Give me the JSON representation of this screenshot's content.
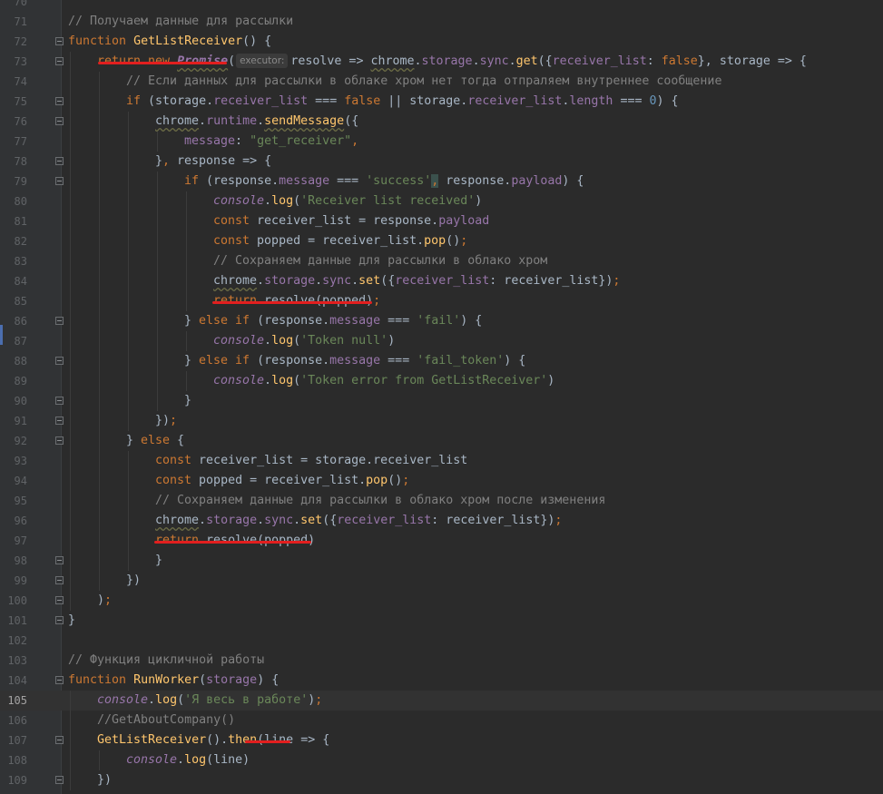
{
  "editor": {
    "current_line": "105",
    "lines": [
      {
        "n": "70",
        "indent": 0,
        "fold": false,
        "tokens": []
      },
      {
        "n": "71",
        "indent": 0,
        "fold": false,
        "tokens": [
          {
            "c": "cm",
            "t": "// Получаем данные для рассылки"
          }
        ]
      },
      {
        "n": "72",
        "indent": 0,
        "fold": true,
        "tokens": [
          {
            "c": "kw",
            "t": "function "
          },
          {
            "c": "fn",
            "t": "GetListReceiver"
          },
          {
            "c": "pl",
            "t": "() {"
          }
        ]
      },
      {
        "n": "73",
        "indent": 1,
        "fold": true,
        "tokens": [
          {
            "c": "kw",
            "t": "return new "
          },
          {
            "c": "cls",
            "t": "Promise"
          },
          {
            "c": "pl",
            "t": "("
          },
          {
            "c": "hint",
            "t": "executor:"
          },
          {
            "c": "pl",
            "t": "resolve => "
          },
          {
            "c": "glob-w",
            "t": "chrome"
          },
          {
            "c": "pl",
            "t": "."
          },
          {
            "c": "prop",
            "t": "storage"
          },
          {
            "c": "pl",
            "t": "."
          },
          {
            "c": "prop",
            "t": "sync"
          },
          {
            "c": "pl",
            "t": "."
          },
          {
            "c": "fn",
            "t": "get"
          },
          {
            "c": "pl",
            "t": "({"
          },
          {
            "c": "prop",
            "t": "receiver_list"
          },
          {
            "c": "pl",
            "t": ": "
          },
          {
            "c": "kw",
            "t": "false"
          },
          {
            "c": "pl",
            "t": "}, storage => {"
          }
        ]
      },
      {
        "n": "74",
        "indent": 2,
        "fold": false,
        "tokens": [
          {
            "c": "cm",
            "t": "// Если данных для рассылки в облаке хром нет тогда отпраляем внутреннее сообщение"
          }
        ]
      },
      {
        "n": "75",
        "indent": 2,
        "fold": true,
        "tokens": [
          {
            "c": "kw",
            "t": "if "
          },
          {
            "c": "pl",
            "t": "(storage."
          },
          {
            "c": "prop",
            "t": "receiver_list"
          },
          {
            "c": "pl",
            "t": " === "
          },
          {
            "c": "kw",
            "t": "false"
          },
          {
            "c": "pl",
            "t": " || storage."
          },
          {
            "c": "prop",
            "t": "receiver_list"
          },
          {
            "c": "pl",
            "t": "."
          },
          {
            "c": "prop",
            "t": "length"
          },
          {
            "c": "pl",
            "t": " === "
          },
          {
            "c": "num",
            "t": "0"
          },
          {
            "c": "pl",
            "t": ") {"
          }
        ]
      },
      {
        "n": "76",
        "indent": 3,
        "fold": true,
        "tokens": [
          {
            "c": "pl-w",
            "t": "chrome"
          },
          {
            "c": "pl",
            "t": "."
          },
          {
            "c": "prop",
            "t": "runtime"
          },
          {
            "c": "pl",
            "t": "."
          },
          {
            "c": "fn-w",
            "t": "sendMessage"
          },
          {
            "c": "pl",
            "t": "({"
          }
        ]
      },
      {
        "n": "77",
        "indent": 4,
        "fold": false,
        "tokens": [
          {
            "c": "prop",
            "t": "message"
          },
          {
            "c": "pl",
            "t": ": "
          },
          {
            "c": "str",
            "t": "\"get_receiver\""
          },
          {
            "c": "kw",
            "t": ","
          }
        ]
      },
      {
        "n": "78",
        "indent": 3,
        "fold": true,
        "tokens": [
          {
            "c": "pl",
            "t": "}"
          },
          {
            "c": "kw",
            "t": ", "
          },
          {
            "c": "pl",
            "t": "response => {"
          }
        ]
      },
      {
        "n": "79",
        "indent": 4,
        "fold": true,
        "tokens": [
          {
            "c": "kw",
            "t": "if "
          },
          {
            "c": "pl",
            "t": "(response."
          },
          {
            "c": "prop",
            "t": "message"
          },
          {
            "c": "pl",
            "t": " === "
          },
          {
            "c": "str",
            "t": "'success'"
          },
          {
            "c": "kw-m",
            "t": ","
          },
          {
            "c": "pl",
            "t": " response."
          },
          {
            "c": "prop",
            "t": "payload"
          },
          {
            "c": "pl",
            "t": ") {"
          }
        ]
      },
      {
        "n": "80",
        "indent": 5,
        "fold": false,
        "tokens": [
          {
            "c": "glob",
            "t": "console"
          },
          {
            "c": "pl",
            "t": "."
          },
          {
            "c": "fn",
            "t": "log"
          },
          {
            "c": "pl",
            "t": "("
          },
          {
            "c": "str",
            "t": "'Receiver list received'"
          },
          {
            "c": "pl",
            "t": ")"
          }
        ]
      },
      {
        "n": "81",
        "indent": 5,
        "fold": false,
        "tokens": [
          {
            "c": "kw",
            "t": "const "
          },
          {
            "c": "pl",
            "t": "receiver_list = response."
          },
          {
            "c": "prop",
            "t": "payload"
          }
        ]
      },
      {
        "n": "82",
        "indent": 5,
        "fold": false,
        "tokens": [
          {
            "c": "kw",
            "t": "const "
          },
          {
            "c": "pl",
            "t": "popped = receiver_list."
          },
          {
            "c": "fn",
            "t": "pop"
          },
          {
            "c": "pl",
            "t": "()"
          },
          {
            "c": "kw",
            "t": ";"
          }
        ]
      },
      {
        "n": "83",
        "indent": 5,
        "fold": false,
        "tokens": [
          {
            "c": "cm",
            "t": "// Сохраняем данные для рассылки в облако хром"
          }
        ]
      },
      {
        "n": "84",
        "indent": 5,
        "fold": false,
        "tokens": [
          {
            "c": "pl-w",
            "t": "chrome"
          },
          {
            "c": "pl",
            "t": "."
          },
          {
            "c": "prop",
            "t": "storage"
          },
          {
            "c": "pl",
            "t": "."
          },
          {
            "c": "prop",
            "t": "sync"
          },
          {
            "c": "pl",
            "t": "."
          },
          {
            "c": "fn",
            "t": "set"
          },
          {
            "c": "pl",
            "t": "({"
          },
          {
            "c": "prop",
            "t": "receiver_list"
          },
          {
            "c": "pl",
            "t": ": receiver_list})"
          },
          {
            "c": "kw",
            "t": ";"
          }
        ]
      },
      {
        "n": "85",
        "indent": 5,
        "fold": false,
        "tokens": [
          {
            "c": "kw",
            "t": "return "
          },
          {
            "c": "pl",
            "t": "resolve(popped)"
          },
          {
            "c": "kw",
            "t": ";"
          }
        ]
      },
      {
        "n": "86",
        "indent": 4,
        "fold": true,
        "tokens": [
          {
            "c": "pl",
            "t": "} "
          },
          {
            "c": "kw",
            "t": "else if "
          },
          {
            "c": "pl",
            "t": "(response."
          },
          {
            "c": "prop",
            "t": "message"
          },
          {
            "c": "pl",
            "t": " === "
          },
          {
            "c": "str",
            "t": "'fail'"
          },
          {
            "c": "pl",
            "t": ") {"
          }
        ]
      },
      {
        "n": "87",
        "indent": 5,
        "fold": false,
        "tokens": [
          {
            "c": "glob",
            "t": "console"
          },
          {
            "c": "pl",
            "t": "."
          },
          {
            "c": "fn",
            "t": "log"
          },
          {
            "c": "pl",
            "t": "("
          },
          {
            "c": "str",
            "t": "'Token null'"
          },
          {
            "c": "pl",
            "t": ")"
          }
        ]
      },
      {
        "n": "88",
        "indent": 4,
        "fold": true,
        "tokens": [
          {
            "c": "pl",
            "t": "} "
          },
          {
            "c": "kw",
            "t": "else if "
          },
          {
            "c": "pl",
            "t": "(response."
          },
          {
            "c": "prop",
            "t": "message"
          },
          {
            "c": "pl",
            "t": " === "
          },
          {
            "c": "str",
            "t": "'fail_token'"
          },
          {
            "c": "pl",
            "t": ") {"
          }
        ]
      },
      {
        "n": "89",
        "indent": 5,
        "fold": false,
        "tokens": [
          {
            "c": "glob",
            "t": "console"
          },
          {
            "c": "pl",
            "t": "."
          },
          {
            "c": "fn",
            "t": "log"
          },
          {
            "c": "pl",
            "t": "("
          },
          {
            "c": "str",
            "t": "'Token error from GetListReceiver'"
          },
          {
            "c": "pl",
            "t": ")"
          }
        ]
      },
      {
        "n": "90",
        "indent": 4,
        "fold": true,
        "tokens": [
          {
            "c": "pl",
            "t": "}"
          }
        ]
      },
      {
        "n": "91",
        "indent": 3,
        "fold": true,
        "tokens": [
          {
            "c": "pl",
            "t": "})"
          },
          {
            "c": "kw",
            "t": ";"
          }
        ]
      },
      {
        "n": "92",
        "indent": 2,
        "fold": true,
        "tokens": [
          {
            "c": "pl",
            "t": "} "
          },
          {
            "c": "kw",
            "t": "else "
          },
          {
            "c": "pl",
            "t": "{"
          }
        ]
      },
      {
        "n": "93",
        "indent": 3,
        "fold": false,
        "tokens": [
          {
            "c": "kw",
            "t": "const "
          },
          {
            "c": "pl",
            "t": "receiver_list = storage.receiver_list"
          }
        ]
      },
      {
        "n": "94",
        "indent": 3,
        "fold": false,
        "tokens": [
          {
            "c": "kw",
            "t": "const "
          },
          {
            "c": "pl",
            "t": "popped = receiver_list."
          },
          {
            "c": "fn",
            "t": "pop"
          },
          {
            "c": "pl",
            "t": "()"
          },
          {
            "c": "kw",
            "t": ";"
          }
        ]
      },
      {
        "n": "95",
        "indent": 3,
        "fold": false,
        "tokens": [
          {
            "c": "cm",
            "t": "// Сохраняем данные для рассылки в облако хром после изменения"
          }
        ]
      },
      {
        "n": "96",
        "indent": 3,
        "fold": false,
        "tokens": [
          {
            "c": "pl-w",
            "t": "chrome"
          },
          {
            "c": "pl",
            "t": "."
          },
          {
            "c": "prop",
            "t": "storage"
          },
          {
            "c": "pl",
            "t": "."
          },
          {
            "c": "prop",
            "t": "sync"
          },
          {
            "c": "pl",
            "t": "."
          },
          {
            "c": "fn",
            "t": "set"
          },
          {
            "c": "pl",
            "t": "({"
          },
          {
            "c": "prop",
            "t": "receiver_list"
          },
          {
            "c": "pl",
            "t": ": receiver_list})"
          },
          {
            "c": "kw",
            "t": ";"
          }
        ]
      },
      {
        "n": "97",
        "indent": 3,
        "fold": false,
        "tokens": [
          {
            "c": "kw",
            "t": "return "
          },
          {
            "c": "pl",
            "t": "resolve(popped)"
          }
        ]
      },
      {
        "n": "98",
        "indent": 3,
        "fold": true,
        "tokens": [
          {
            "c": "pl",
            "t": "}"
          }
        ]
      },
      {
        "n": "99",
        "indent": 2,
        "fold": true,
        "tokens": [
          {
            "c": "pl",
            "t": "})"
          }
        ]
      },
      {
        "n": "100",
        "indent": 1,
        "fold": true,
        "tokens": [
          {
            "c": "pl",
            "t": ")"
          },
          {
            "c": "kw",
            "t": ";"
          }
        ]
      },
      {
        "n": "101",
        "indent": 0,
        "fold": true,
        "tokens": [
          {
            "c": "pl",
            "t": "}"
          }
        ]
      },
      {
        "n": "102",
        "indent": 0,
        "fold": false,
        "tokens": []
      },
      {
        "n": "103",
        "indent": 0,
        "fold": false,
        "tokens": [
          {
            "c": "cm",
            "t": "// Функция цикличной работы"
          }
        ]
      },
      {
        "n": "104",
        "indent": 0,
        "fold": true,
        "tokens": [
          {
            "c": "kw",
            "t": "function "
          },
          {
            "c": "fn",
            "t": "RunWorker"
          },
          {
            "c": "pl",
            "t": "("
          },
          {
            "c": "prop",
            "t": "storage"
          },
          {
            "c": "pl",
            "t": ") {"
          }
        ]
      },
      {
        "n": "105",
        "indent": 1,
        "fold": false,
        "tokens": [
          {
            "c": "glob",
            "t": "console"
          },
          {
            "c": "pl",
            "t": "."
          },
          {
            "c": "fn",
            "t": "log"
          },
          {
            "c": "pl",
            "t": "("
          },
          {
            "c": "str",
            "t": "'Я весь в работе'"
          },
          {
            "c": "pl",
            "t": ")"
          },
          {
            "c": "kw",
            "t": ";"
          }
        ]
      },
      {
        "n": "106",
        "indent": 1,
        "fold": false,
        "tokens": [
          {
            "c": "cm",
            "t": "//GetAboutCompany()"
          }
        ]
      },
      {
        "n": "107",
        "indent": 1,
        "fold": true,
        "tokens": [
          {
            "c": "fn",
            "t": "GetListReceiver"
          },
          {
            "c": "pl",
            "t": "()."
          },
          {
            "c": "fn",
            "t": "then"
          },
          {
            "c": "pl",
            "t": "(line => {"
          }
        ]
      },
      {
        "n": "108",
        "indent": 2,
        "fold": false,
        "tokens": [
          {
            "c": "glob",
            "t": "console"
          },
          {
            "c": "pl",
            "t": "."
          },
          {
            "c": "fn",
            "t": "log"
          },
          {
            "c": "pl",
            "t": "(line)"
          }
        ]
      },
      {
        "n": "109",
        "indent": 1,
        "fold": true,
        "tokens": [
          {
            "c": "pl",
            "t": "})"
          }
        ]
      }
    ],
    "annotation_color": "#e21f1f",
    "annotations": [
      "73: return new Promise",
      "85: return resolve(popped)",
      "97: return resolve(popped)",
      "107: .then(line"
    ]
  }
}
